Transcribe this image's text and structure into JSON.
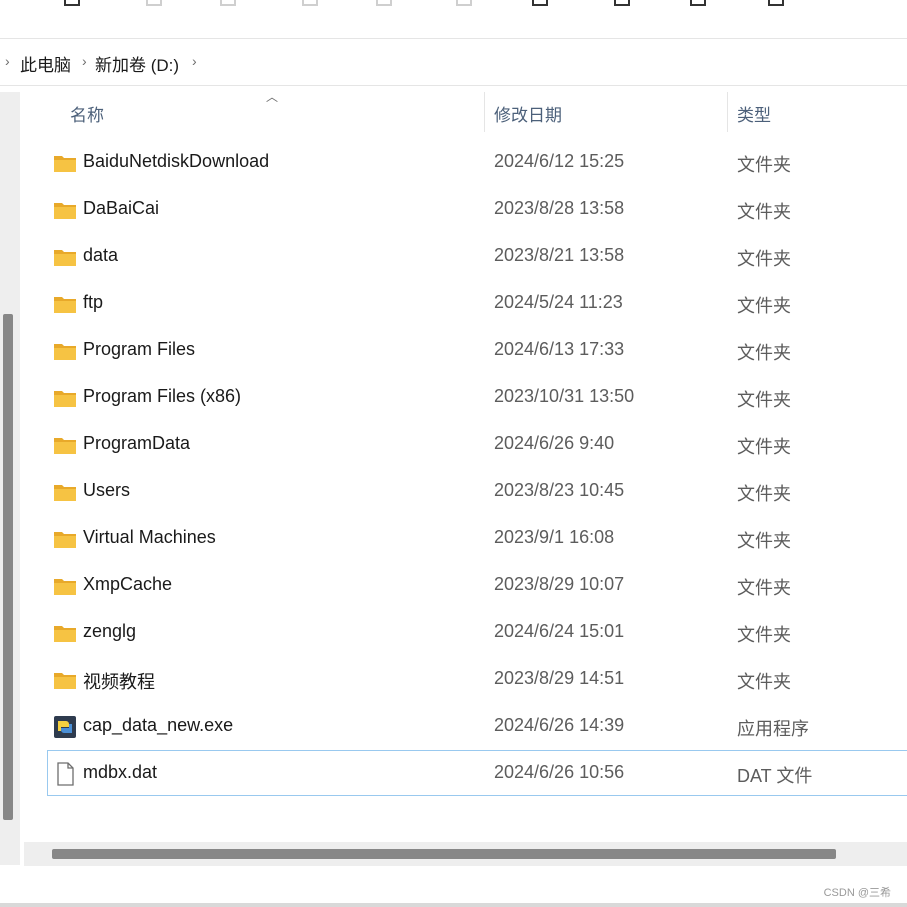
{
  "breadcrumb": {
    "items": [
      "此电脑",
      "新加卷 (D:)"
    ]
  },
  "columns": {
    "name": "名称",
    "date": "修改日期",
    "type": "类型"
  },
  "files": [
    {
      "name": "BaiduNetdiskDownload",
      "date": "2024/6/12 15:25",
      "type": "文件夹",
      "icon": "folder-icon"
    },
    {
      "name": "DaBaiCai",
      "date": "2023/8/28 13:58",
      "type": "文件夹",
      "icon": "folder-icon"
    },
    {
      "name": "data",
      "date": "2023/8/21 13:58",
      "type": "文件夹",
      "icon": "folder-icon"
    },
    {
      "name": "ftp",
      "date": "2024/5/24 11:23",
      "type": "文件夹",
      "icon": "folder-icon"
    },
    {
      "name": "Program Files",
      "date": "2024/6/13 17:33",
      "type": "文件夹",
      "icon": "folder-icon"
    },
    {
      "name": "Program Files (x86)",
      "date": "2023/10/31 13:50",
      "type": "文件夹",
      "icon": "folder-icon"
    },
    {
      "name": "ProgramData",
      "date": "2024/6/26 9:40",
      "type": "文件夹",
      "icon": "folder-icon"
    },
    {
      "name": "Users",
      "date": "2023/8/23 10:45",
      "type": "文件夹",
      "icon": "folder-icon"
    },
    {
      "name": "Virtual Machines",
      "date": "2023/9/1 16:08",
      "type": "文件夹",
      "icon": "folder-icon"
    },
    {
      "name": "XmpCache",
      "date": "2023/8/29 10:07",
      "type": "文件夹",
      "icon": "folder-icon"
    },
    {
      "name": "zenglg",
      "date": "2024/6/24 15:01",
      "type": "文件夹",
      "icon": "folder-icon"
    },
    {
      "name": "视频教程",
      "date": "2023/8/29 14:51",
      "type": "文件夹",
      "icon": "folder-icon"
    },
    {
      "name": "cap_data_new.exe",
      "date": "2024/6/26 14:39",
      "type": "应用程序",
      "icon": "python-exe-icon"
    },
    {
      "name": "mdbx.dat",
      "date": "2024/6/26 10:56",
      "type": "DAT 文件",
      "icon": "file-icon",
      "selected": true
    }
  ],
  "watermark": "CSDN @三希",
  "colors": {
    "folder": "#f6c343",
    "folder_tab": "#e8a92a",
    "selection_border": "#99c9ef",
    "header_text": "#4c607a"
  }
}
